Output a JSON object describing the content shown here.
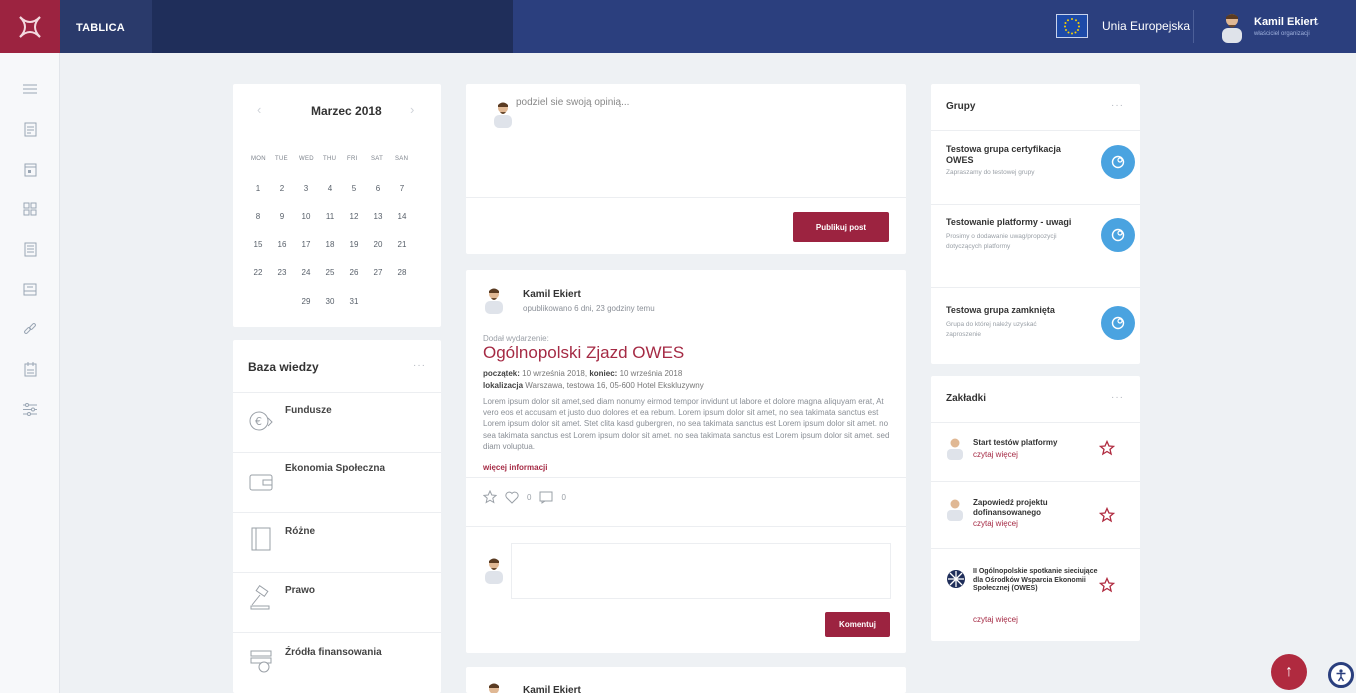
{
  "topbar": {
    "nav_active": "TABLICA",
    "eu_label": "Unia Europejska",
    "user_name": "Kamil Ekiert",
    "user_role": "właściciel organizacji"
  },
  "rail": {
    "icons": [
      "list-icon",
      "document-icon",
      "calendar-icon",
      "grid-icon",
      "form-icon",
      "archive-icon",
      "link-icon",
      "calendar-check-icon",
      "sliders-icon"
    ]
  },
  "calendar": {
    "month": "Marzec 2018",
    "weekdays": [
      "MON",
      "TUE",
      "WED",
      "THU",
      "FRI",
      "SAT",
      "SAN"
    ],
    "weeks": [
      [
        "1",
        "2",
        "3",
        "4",
        "5",
        "6",
        "7"
      ],
      [
        "8",
        "9",
        "10",
        "11",
        "12",
        "13",
        "14"
      ],
      [
        "15",
        "16",
        "17",
        "18",
        "19",
        "20",
        "21"
      ],
      [
        "22",
        "23",
        "24",
        "25",
        "26",
        "27",
        "28"
      ],
      [
        "",
        "",
        "29",
        "30",
        "31",
        "",
        ""
      ]
    ]
  },
  "knowledge": {
    "title": "Baza wiedzy",
    "items": [
      {
        "label": "Fundusze",
        "icon": "coins-icon"
      },
      {
        "label": "Ekonomia Społeczna",
        "icon": "wallet-icon"
      },
      {
        "label": "Różne",
        "icon": "notebook-icon"
      },
      {
        "label": "Prawo",
        "icon": "gavel-icon"
      },
      {
        "label": "Źródła finansowania",
        "icon": "money-stack-icon"
      }
    ]
  },
  "compose": {
    "placeholder": "podziel sie swoją opinią...",
    "publish_label": "Publikuj post"
  },
  "post": {
    "author": "Kamil Ekiert",
    "meta": "opublikowano 6 dni, 23 godziny temu",
    "added": "Dodał wydarzenie:",
    "heading": "Ogólnopolski Zjazd OWES",
    "start_label": "początek:",
    "start_value": "10 września 2018,",
    "end_label": "koniec:",
    "end_value": "10 września 2018",
    "location_label": "lokalizacja",
    "location_value": "Warszawa, testowa 16, 05-600 Hotel Ekskluzywny",
    "body": "Lorem ipsum dolor sit amet,sed diam nonumy eirmod tempor invidunt ut labore et dolore magna aliquyam erat, At vero eos et accusam et justo duo dolores et ea rebum. Lorem ipsum dolor sit amet, no sea takimata sanctus est Lorem ipsum dolor sit amet. Stet clita kasd gubergren, no sea takimata sanctus est Lorem ipsum dolor sit amet. no sea takimata sanctus est Lorem ipsum dolor sit amet. no sea takimata sanctus est Lorem ipsum dolor sit amet. sed diam voluptua.",
    "more": "więcej informacji",
    "likes": "0",
    "comments": "0",
    "comment_label": "Komentuj"
  },
  "next_post": {
    "author": "Kamil Ekiert"
  },
  "groups": {
    "title": "Grupy",
    "items": [
      {
        "title": "Testowa grupa certyfikacja OWES",
        "desc": "Zapraszamy do testowej grupy"
      },
      {
        "title": "Testowanie platformy - uwagi",
        "desc": "Prosimy o dodawanie uwag/propozycji dotyczących platformy"
      },
      {
        "title": "Testowa grupa zamknięta",
        "desc": "Grupa do której należy uzyskać zaproszenie"
      }
    ]
  },
  "bookmarks": {
    "title": "Zakładki",
    "read_more": "czytaj więcej",
    "items": [
      {
        "title": "Start testów platformy"
      },
      {
        "title": "Zapowiedź projektu dofinansowanego"
      },
      {
        "title": "II Ogólnopolskie spotkanie sieciujące dla Ośrodków Wsparcia Ekonomii Społecznej (OWES)"
      }
    ]
  },
  "colors": {
    "brand": "#9c2340",
    "navy": "#1f2e5a",
    "accent_blue": "#4aa3e0"
  }
}
